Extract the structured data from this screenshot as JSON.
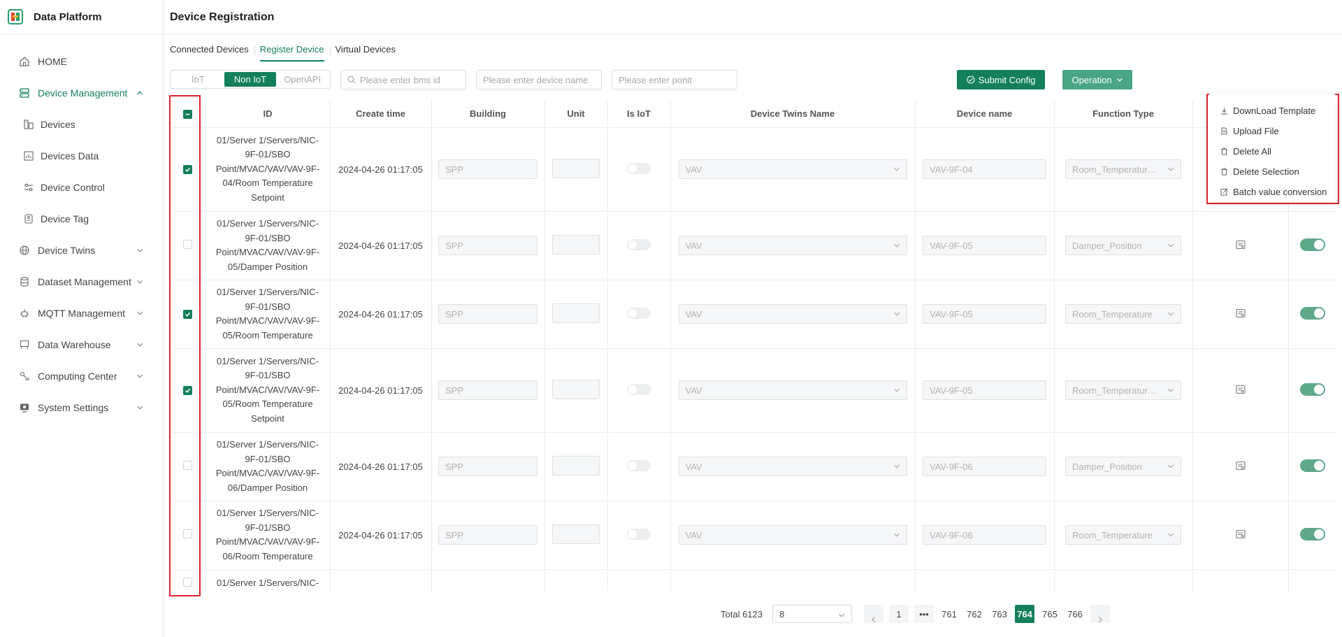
{
  "app": {
    "name": "Data Platform",
    "accent": "#137f5c"
  },
  "sidebar": {
    "items": [
      {
        "label": "HOME",
        "icon": "home-icon"
      },
      {
        "label": "Device Management",
        "icon": "server-icon",
        "active": true,
        "expanded": true
      },
      {
        "label": "Devices",
        "icon": "devices-icon",
        "sub": true
      },
      {
        "label": "Devices Data",
        "icon": "devices-data-icon",
        "sub": true
      },
      {
        "label": "Device Control",
        "icon": "sliders-icon",
        "sub": true
      },
      {
        "label": "Device Tag",
        "icon": "tag-icon",
        "sub": true
      },
      {
        "label": "Device Twins",
        "icon": "globe-icon"
      },
      {
        "label": "Dataset Management",
        "icon": "database-icon"
      },
      {
        "label": "MQTT Management",
        "icon": "mqtt-icon"
      },
      {
        "label": "Data Warehouse",
        "icon": "warehouse-icon"
      },
      {
        "label": "Computing Center",
        "icon": "compute-icon"
      },
      {
        "label": "System Settings",
        "icon": "monitor-icon"
      }
    ]
  },
  "page": {
    "title": "Device Registration",
    "tabs": [
      "Connected Devices",
      "Register Device",
      "Virtual Devices"
    ],
    "active_tab": "Register Device"
  },
  "toolbar": {
    "segments": [
      "IoT",
      "Non IoT",
      "OpenAPI"
    ],
    "active_segment": "Non IoT",
    "bms_placeholder": "Please enter bms id",
    "name_placeholder": "Please enter device name",
    "point_placeholder": "Please enter ponit",
    "submit_label": "Submit Config",
    "operation_label": "Operation"
  },
  "operation_menu": [
    "DownLoad Template",
    "Upload File",
    "Delete All",
    "Delete Selection",
    "Batch value conversion"
  ],
  "table": {
    "headers": [
      "ID",
      "Create time",
      "Building",
      "Unit",
      "Is IoT",
      "Device Twins Name",
      "Device name",
      "Function Type"
    ],
    "rows": [
      {
        "checked": true,
        "id_lines": [
          "01/Server 1/Servers/NIC-",
          "9F-01/SBO",
          "Point/MVAC/VAV/VAV-9F-",
          "04/Room Temperature",
          "Setpoint"
        ],
        "time": "2024-04-26 01:17:05",
        "building": "SPP",
        "twins": "VAV",
        "device": "VAV-9F-04",
        "function": "Room_Temperatur…",
        "enabled": true
      },
      {
        "checked": false,
        "id_lines": [
          "01/Server 1/Servers/NIC-",
          "9F-01/SBO",
          "Point/MVAC/VAV/VAV-9F-",
          "05/Damper Position"
        ],
        "time": "2024-04-26 01:17:05",
        "building": "SPP",
        "twins": "VAV",
        "device": "VAV-9F-05",
        "function": "Damper_Position",
        "enabled": true
      },
      {
        "checked": true,
        "id_lines": [
          "01/Server 1/Servers/NIC-",
          "9F-01/SBO",
          "Point/MVAC/VAV/VAV-9F-",
          "05/Room Temperature"
        ],
        "time": "2024-04-26 01:17:05",
        "building": "SPP",
        "twins": "VAV",
        "device": "VAV-9F-05",
        "function": "Room_Temperature",
        "enabled": true
      },
      {
        "checked": true,
        "id_lines": [
          "01/Server 1/Servers/NIC-",
          "9F-01/SBO",
          "Point/MVAC/VAV/VAV-9F-",
          "05/Room Temperature",
          "Setpoint"
        ],
        "time": "2024-04-26 01:17:05",
        "building": "SPP",
        "twins": "VAV",
        "device": "VAV-9F-05",
        "function": "Room_Temperatur…",
        "enabled": true
      },
      {
        "checked": false,
        "id_lines": [
          "01/Server 1/Servers/NIC-",
          "9F-01/SBO",
          "Point/MVAC/VAV/VAV-9F-",
          "06/Damper Position"
        ],
        "time": "2024-04-26 01:17:05",
        "building": "SPP",
        "twins": "VAV",
        "device": "VAV-9F-06",
        "function": "Damper_Position",
        "enabled": true
      },
      {
        "checked": false,
        "id_lines": [
          "01/Server 1/Servers/NIC-",
          "9F-01/SBO",
          "Point/MVAC/VAV/VAV-9F-",
          "06/Room Temperature"
        ],
        "time": "2024-04-26 01:17:05",
        "building": "SPP",
        "twins": "VAV",
        "device": "VAV-9F-06",
        "function": "Room_Temperature",
        "enabled": true
      },
      {
        "checked": false,
        "id_lines": [
          "01/Server 1/Servers/NIC-"
        ],
        "time": "",
        "building": "",
        "twins": "",
        "device": "",
        "function": "",
        "enabled": null,
        "partial": true
      }
    ]
  },
  "pagination": {
    "total_label": "Total 6123",
    "page_size": "8",
    "pages": [
      "1",
      "•••",
      "761",
      "762",
      "763",
      "764",
      "765",
      "766"
    ],
    "current": "764"
  }
}
